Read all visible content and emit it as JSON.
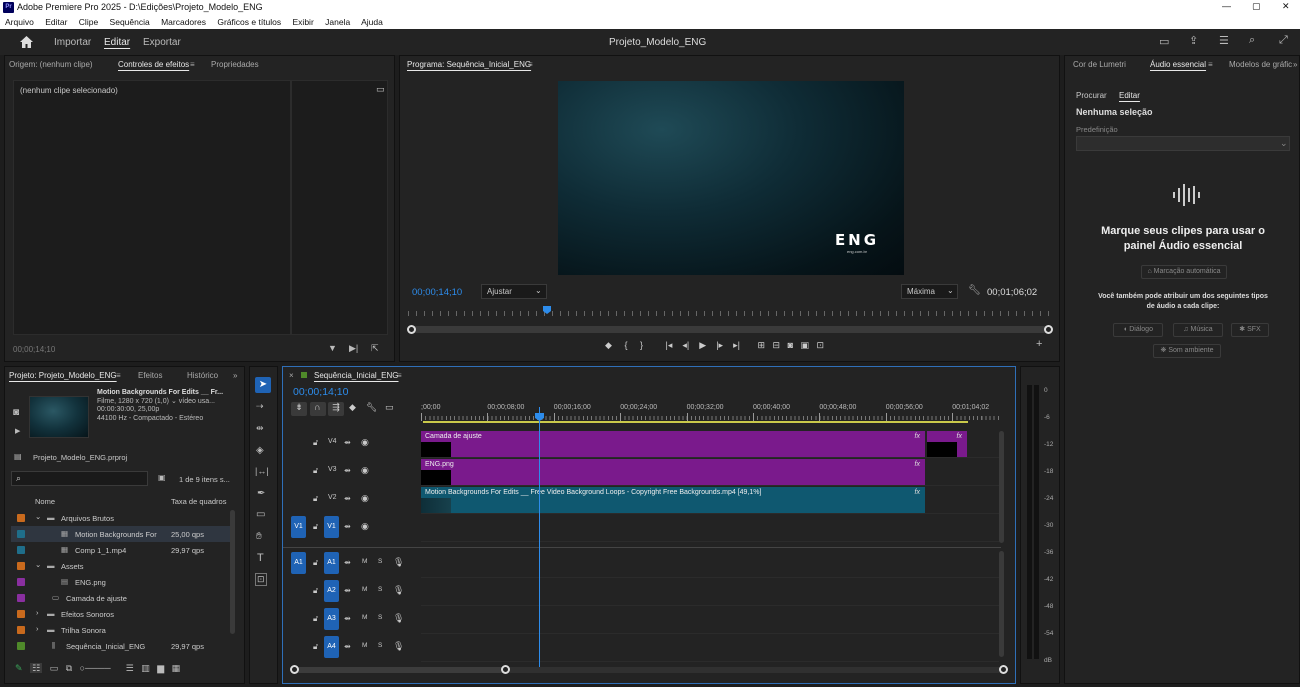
{
  "window": {
    "title": "Adobe Premiere Pro 2025 - D:\\Edições\\Projeto_Modelo_ENG",
    "app_badge": "Pr",
    "controls": [
      "—",
      "▢",
      "✕"
    ]
  },
  "menu": [
    "Arquivo",
    "Editar",
    "Clipe",
    "Sequência",
    "Marcadores",
    "Gráficos e títulos",
    "Exibir",
    "Janela",
    "Ajuda"
  ],
  "workspace": {
    "tabs": [
      "Importar",
      "Editar",
      "Exportar"
    ],
    "active": "Editar",
    "project_title": "Projeto_Modelo_ENG"
  },
  "source_panel": {
    "tabs": [
      "Origem: (nenhum clipe)",
      "Controles de efeitos",
      "Propriedades"
    ],
    "empty_text": "(nenhum clipe selecionado)",
    "timecode": "00;00;14;10"
  },
  "program": {
    "title": "Programa: Sequência_Inicial_ENG",
    "timecode": "00;00;14;10",
    "fit": "Ajustar",
    "quality": "Máxima",
    "duration": "00;01;06;02",
    "logo": "ENG",
    "logo_sub": "eng.com.br"
  },
  "right_panel": {
    "tabs": [
      "Cor de Lumetri",
      "Áudio essencial",
      "Modelos de gráfic"
    ],
    "subtabs": [
      "Procurar",
      "Editar"
    ],
    "no_selection": "Nenhuma seleção",
    "preset_label": "Predefinição",
    "headline": "Marque seus clipes para usar o painel Áudio essencial",
    "auto_tag": "Marcação automática",
    "also_text": "Você também pode atribuir um dos seguintes tipos de áudio a cada clipe:",
    "types": [
      "Diálogo",
      "Música",
      "SFX",
      "Som ambiente"
    ]
  },
  "project": {
    "tabs": [
      "Projeto: Projeto_Modelo_ENG",
      "Efeitos",
      "Histórico"
    ],
    "thumb_title": "Motion Backgrounds For Edits __ Fr...",
    "thumb_line1": "Filme, 1280 x 720 (1,0)",
    "thumb_line1b": "vídeo usa...",
    "thumb_line2": "00:00:30:00, 25,00p",
    "thumb_line3": "44100 Hz - Compactado - Estéreo",
    "project_file": "Projeto_Modelo_ENG.prproj",
    "item_count": "1 de 9 itens s...",
    "col_name": "Nome",
    "col_rate": "Taxa de quadros",
    "items": [
      {
        "name": "Arquivos Brutos",
        "rate": "",
        "color": "#c96a1d",
        "indent": 0,
        "type": "folder-open"
      },
      {
        "name": "Motion Backgrounds For",
        "rate": "25,00 qps",
        "color": "#1f6e8a",
        "indent": 2,
        "type": "video"
      },
      {
        "name": "Comp 1_1.mp4",
        "rate": "29,97 qps",
        "color": "#1f6e8a",
        "indent": 2,
        "type": "video"
      },
      {
        "name": "Assets",
        "rate": "",
        "color": "#c96a1d",
        "indent": 0,
        "type": "folder-open"
      },
      {
        "name": "ENG.png",
        "rate": "",
        "color": "#8a2fa0",
        "indent": 2,
        "type": "image"
      },
      {
        "name": "Camada de ajuste",
        "rate": "",
        "color": "#8a2fa0",
        "indent": 1,
        "type": "adjust"
      },
      {
        "name": "Efeitos Sonoros",
        "rate": "",
        "color": "#c96a1d",
        "indent": 0,
        "type": "folder"
      },
      {
        "name": "Trilha Sonora",
        "rate": "",
        "color": "#c96a1d",
        "indent": 0,
        "type": "folder"
      },
      {
        "name": "Sequência_Inicial_ENG",
        "rate": "29,97 qps",
        "color": "#4f8a2a",
        "indent": 1,
        "type": "sequence"
      }
    ]
  },
  "timeline": {
    "title": "Sequência_Inicial_ENG",
    "timecode": "00;00;14;10",
    "ruler": [
      ";00;00",
      "00;00;08;00",
      "00;00;16;00",
      "00;00;24;00",
      "00;00;32;00",
      "00;00;40;00",
      "00;00;48;00",
      "00;00;56;00",
      "00;01;04;02"
    ],
    "video_tracks": [
      "V4",
      "V3",
      "V2",
      "V1"
    ],
    "audio_tracks": [
      "A1",
      "A2",
      "A3",
      "A4"
    ],
    "clips": {
      "adjust": "Camada de ajuste",
      "eng": "ENG.png",
      "motion": "Motion Backgrounds For Edits __ Free Video Background Loops - Copyright Free Backgrounds.mp4 [49,1%]",
      "fx": "fx"
    },
    "ms": [
      "M",
      "S"
    ]
  },
  "meter": {
    "ticks": [
      "0",
      "-6",
      "-12",
      "-18",
      "-24",
      "-30",
      "-36",
      "-42",
      "-48",
      "-54",
      "dB"
    ]
  },
  "colors": {
    "accent": "#2d8ceb",
    "purple": "#7a1a8c",
    "teal": "#0f5870"
  }
}
